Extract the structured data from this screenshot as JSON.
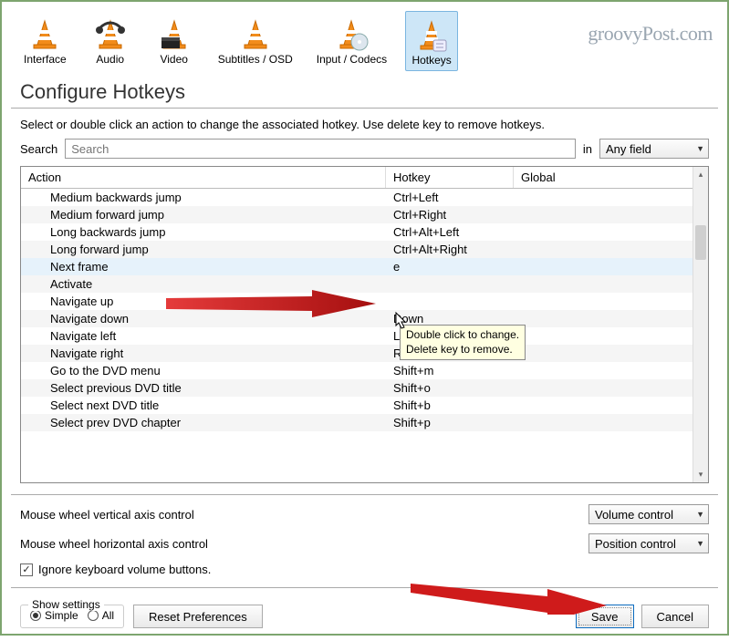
{
  "watermark": "groovyPost.com",
  "tabs": [
    {
      "label": "Interface",
      "icon": "cone"
    },
    {
      "label": "Audio",
      "icon": "cone-headphones"
    },
    {
      "label": "Video",
      "icon": "cone-clapper"
    },
    {
      "label": "Subtitles / OSD",
      "icon": "cone"
    },
    {
      "label": "Input / Codecs",
      "icon": "cone-disc"
    },
    {
      "label": "Hotkeys",
      "icon": "cone-keys",
      "active": true
    }
  ],
  "heading": "Configure Hotkeys",
  "instructions": "Select or double click an action to change the associated hotkey. Use delete key to remove hotkeys.",
  "search": {
    "label": "Search",
    "placeholder": "Search",
    "in_label": "in",
    "scope": "Any field"
  },
  "columns": {
    "action": "Action",
    "hotkey": "Hotkey",
    "global": "Global"
  },
  "rows": [
    {
      "action": "Medium backwards jump",
      "hotkey": "Ctrl+Left",
      "global": ""
    },
    {
      "action": "Medium forward jump",
      "hotkey": "Ctrl+Right",
      "global": ""
    },
    {
      "action": "Long backwards jump",
      "hotkey": "Ctrl+Alt+Left",
      "global": ""
    },
    {
      "action": "Long forward jump",
      "hotkey": "Ctrl+Alt+Right",
      "global": ""
    },
    {
      "action": "Next frame",
      "hotkey": "e",
      "global": "",
      "selected": true
    },
    {
      "action": "Activate",
      "hotkey": "",
      "global": ""
    },
    {
      "action": "Navigate up",
      "hotkey": "",
      "global": ""
    },
    {
      "action": "Navigate down",
      "hotkey": "Down",
      "global": ""
    },
    {
      "action": "Navigate left",
      "hotkey": "Left",
      "global": ""
    },
    {
      "action": "Navigate right",
      "hotkey": "Right",
      "global": ""
    },
    {
      "action": "Go to the DVD menu",
      "hotkey": "Shift+m",
      "global": ""
    },
    {
      "action": "Select previous DVD title",
      "hotkey": "Shift+o",
      "global": ""
    },
    {
      "action": "Select next DVD title",
      "hotkey": "Shift+b",
      "global": ""
    },
    {
      "action": "Select prev DVD chapter",
      "hotkey": "Shift+p",
      "global": ""
    }
  ],
  "tooltip": {
    "line1": "Double click to change.",
    "line2": "Delete key to remove."
  },
  "mouse_wheel_vertical": {
    "label": "Mouse wheel vertical axis control",
    "value": "Volume control"
  },
  "mouse_wheel_horizontal": {
    "label": "Mouse wheel horizontal axis control",
    "value": "Position control"
  },
  "ignore_kb_volume": "Ignore keyboard volume buttons.",
  "show_settings": {
    "legend": "Show settings",
    "simple": "Simple",
    "all": "All"
  },
  "buttons": {
    "reset": "Reset Preferences",
    "save": "Save",
    "cancel": "Cancel"
  },
  "colors": {
    "accent": "#0b6bbf",
    "arrow": "#cf1b1b"
  }
}
